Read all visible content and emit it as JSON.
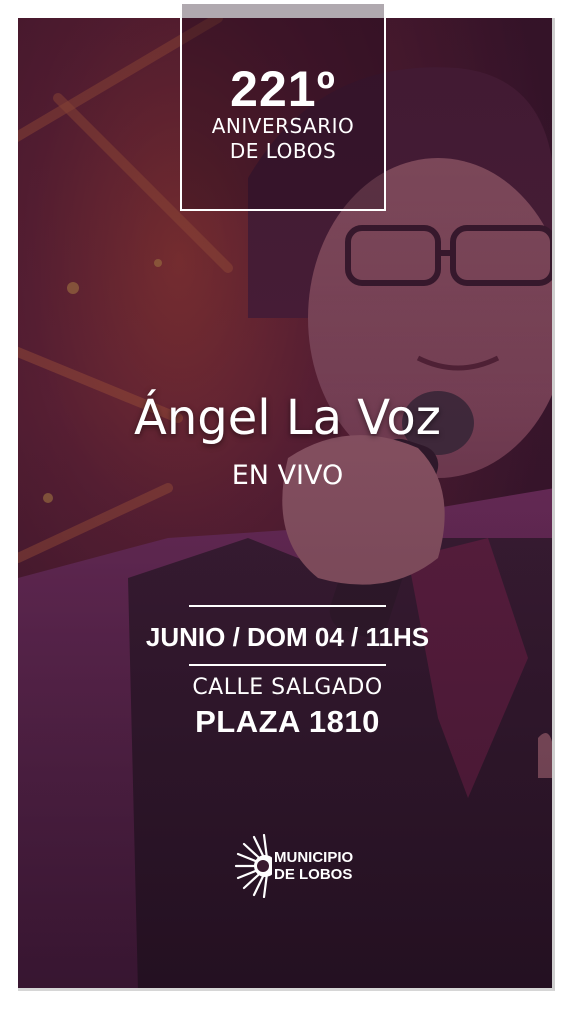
{
  "event": {
    "anniversary_number": "221º",
    "anniversary_line1": "ANIVERSARIO",
    "anniversary_line2": "DE LOBOS",
    "artist": "Ángel La Voz",
    "live": "EN VIVO",
    "date": "JUNIO / DOM 04 / 11HS",
    "street": "CALLE SALGADO",
    "place": "PLAZA 1810"
  },
  "logo": {
    "line1": "MUNICIPIO",
    "line2": "DE LOBOS",
    "icon": "sun-emblem-icon"
  },
  "colors": {
    "text": "#ffffff",
    "background_tint": "#5a2a45"
  }
}
